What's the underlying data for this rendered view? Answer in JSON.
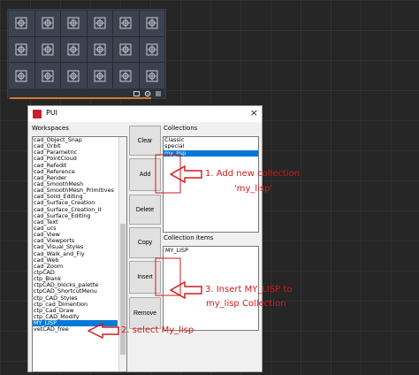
{
  "dialog": {
    "title": "PUI",
    "close_icon": "×",
    "workspaces_label": "Workspaces",
    "collections_label": "Collections",
    "collection_items_label": "Collection items"
  },
  "workspaces": [
    "cad_Object_Snap",
    "cad_Orbit",
    "cad_Parametric",
    "cad_PointCloud",
    "cad_Refedit",
    "cad_Reference",
    "cad_Render",
    "cad_SmoothMesh",
    "cad_SmoothMesh_Primitives",
    "cad_Solid_Editing",
    "cad_Surface_Creation",
    "cad_Surface_Creation_II",
    "cad_Surface_Editing",
    "cad_Text",
    "cad_ucs",
    "cad_View",
    "cad_Viewports",
    "cad_Visual_Styles",
    "cad_Walk_and_Fly",
    "cad_Web",
    "cad_Zoom",
    "ctpCAD",
    "ctp_Blank",
    "ctpCAD_blocks_palette",
    "ctpCAD_ShortcutMenu",
    "ctp_CAD_Styles",
    "ctp_cad_Dimention",
    "ctp_Cad_Draw",
    "ctp_CAD_Modify",
    "MY_LISP",
    "vetCAD_free"
  ],
  "selected_workspace": "MY_LISP",
  "buttons": {
    "clear": "Clear",
    "add": "Add",
    "delete": "Delete",
    "copy": "Copy",
    "insert": "Insert",
    "remove": "Remove"
  },
  "collections": [
    "Classic",
    "special",
    "my_lisp"
  ],
  "selected_collection": "my_lisp",
  "collection_items": [
    "MY_LISP"
  ],
  "annotations": {
    "step1_line1": "1. Add new collection",
    "step1_line2": "'my_lisp'",
    "step2": "2. select My_lisp",
    "step3_line1": "3. Insert MY_LISP to",
    "step3_line2": "my_lisp Collection"
  },
  "colors": {
    "accent_selection": "#0078d7",
    "annotation": "#d11a1a",
    "palette_progress": "#d4782f"
  },
  "palette": {
    "tile_icon": "block-insert-icon",
    "tile_count": 18,
    "toolbar_icons": [
      "refresh-icon",
      "gear-icon",
      "menu-icon"
    ]
  }
}
